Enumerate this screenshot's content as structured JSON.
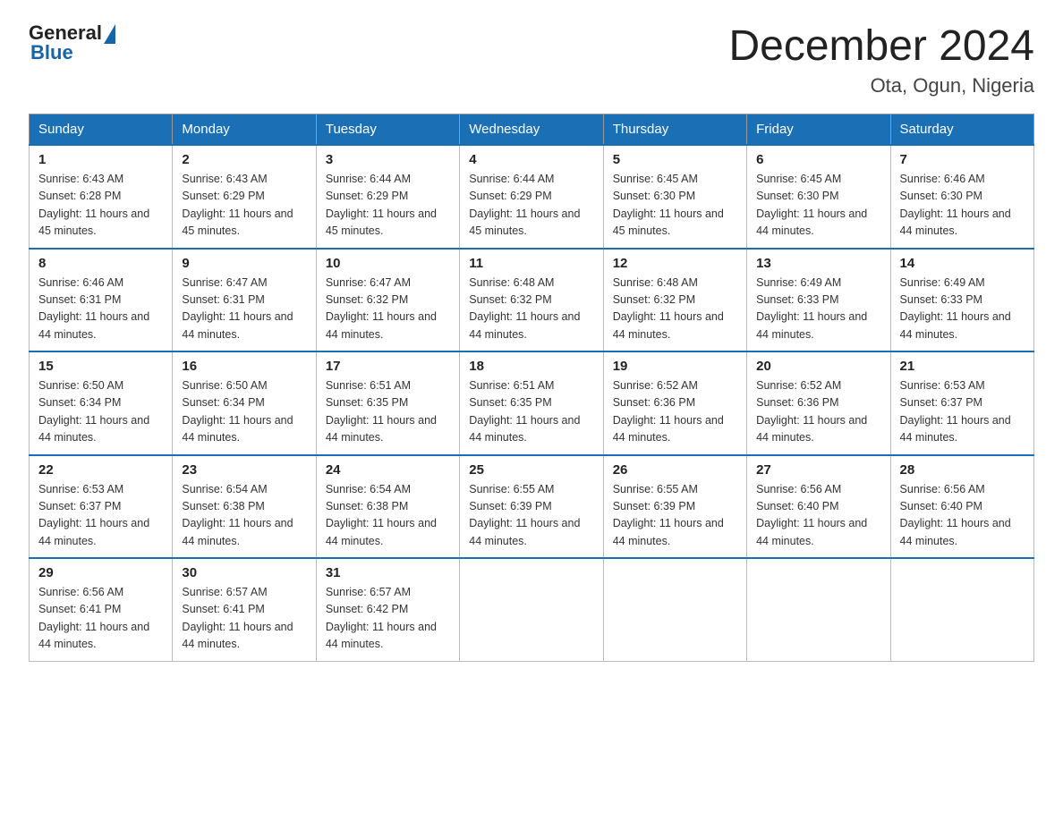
{
  "logo": {
    "general": "General",
    "blue": "Blue"
  },
  "title": "December 2024",
  "subtitle": "Ota, Ogun, Nigeria",
  "weekdays": [
    "Sunday",
    "Monday",
    "Tuesday",
    "Wednesday",
    "Thursday",
    "Friday",
    "Saturday"
  ],
  "weeks": [
    [
      {
        "day": "1",
        "sunrise": "6:43 AM",
        "sunset": "6:28 PM",
        "daylight": "11 hours and 45 minutes."
      },
      {
        "day": "2",
        "sunrise": "6:43 AM",
        "sunset": "6:29 PM",
        "daylight": "11 hours and 45 minutes."
      },
      {
        "day": "3",
        "sunrise": "6:44 AM",
        "sunset": "6:29 PM",
        "daylight": "11 hours and 45 minutes."
      },
      {
        "day": "4",
        "sunrise": "6:44 AM",
        "sunset": "6:29 PM",
        "daylight": "11 hours and 45 minutes."
      },
      {
        "day": "5",
        "sunrise": "6:45 AM",
        "sunset": "6:30 PM",
        "daylight": "11 hours and 45 minutes."
      },
      {
        "day": "6",
        "sunrise": "6:45 AM",
        "sunset": "6:30 PM",
        "daylight": "11 hours and 44 minutes."
      },
      {
        "day": "7",
        "sunrise": "6:46 AM",
        "sunset": "6:30 PM",
        "daylight": "11 hours and 44 minutes."
      }
    ],
    [
      {
        "day": "8",
        "sunrise": "6:46 AM",
        "sunset": "6:31 PM",
        "daylight": "11 hours and 44 minutes."
      },
      {
        "day": "9",
        "sunrise": "6:47 AM",
        "sunset": "6:31 PM",
        "daylight": "11 hours and 44 minutes."
      },
      {
        "day": "10",
        "sunrise": "6:47 AM",
        "sunset": "6:32 PM",
        "daylight": "11 hours and 44 minutes."
      },
      {
        "day": "11",
        "sunrise": "6:48 AM",
        "sunset": "6:32 PM",
        "daylight": "11 hours and 44 minutes."
      },
      {
        "day": "12",
        "sunrise": "6:48 AM",
        "sunset": "6:32 PM",
        "daylight": "11 hours and 44 minutes."
      },
      {
        "day": "13",
        "sunrise": "6:49 AM",
        "sunset": "6:33 PM",
        "daylight": "11 hours and 44 minutes."
      },
      {
        "day": "14",
        "sunrise": "6:49 AM",
        "sunset": "6:33 PM",
        "daylight": "11 hours and 44 minutes."
      }
    ],
    [
      {
        "day": "15",
        "sunrise": "6:50 AM",
        "sunset": "6:34 PM",
        "daylight": "11 hours and 44 minutes."
      },
      {
        "day": "16",
        "sunrise": "6:50 AM",
        "sunset": "6:34 PM",
        "daylight": "11 hours and 44 minutes."
      },
      {
        "day": "17",
        "sunrise": "6:51 AM",
        "sunset": "6:35 PM",
        "daylight": "11 hours and 44 minutes."
      },
      {
        "day": "18",
        "sunrise": "6:51 AM",
        "sunset": "6:35 PM",
        "daylight": "11 hours and 44 minutes."
      },
      {
        "day": "19",
        "sunrise": "6:52 AM",
        "sunset": "6:36 PM",
        "daylight": "11 hours and 44 minutes."
      },
      {
        "day": "20",
        "sunrise": "6:52 AM",
        "sunset": "6:36 PM",
        "daylight": "11 hours and 44 minutes."
      },
      {
        "day": "21",
        "sunrise": "6:53 AM",
        "sunset": "6:37 PM",
        "daylight": "11 hours and 44 minutes."
      }
    ],
    [
      {
        "day": "22",
        "sunrise": "6:53 AM",
        "sunset": "6:37 PM",
        "daylight": "11 hours and 44 minutes."
      },
      {
        "day": "23",
        "sunrise": "6:54 AM",
        "sunset": "6:38 PM",
        "daylight": "11 hours and 44 minutes."
      },
      {
        "day": "24",
        "sunrise": "6:54 AM",
        "sunset": "6:38 PM",
        "daylight": "11 hours and 44 minutes."
      },
      {
        "day": "25",
        "sunrise": "6:55 AM",
        "sunset": "6:39 PM",
        "daylight": "11 hours and 44 minutes."
      },
      {
        "day": "26",
        "sunrise": "6:55 AM",
        "sunset": "6:39 PM",
        "daylight": "11 hours and 44 minutes."
      },
      {
        "day": "27",
        "sunrise": "6:56 AM",
        "sunset": "6:40 PM",
        "daylight": "11 hours and 44 minutes."
      },
      {
        "day": "28",
        "sunrise": "6:56 AM",
        "sunset": "6:40 PM",
        "daylight": "11 hours and 44 minutes."
      }
    ],
    [
      {
        "day": "29",
        "sunrise": "6:56 AM",
        "sunset": "6:41 PM",
        "daylight": "11 hours and 44 minutes."
      },
      {
        "day": "30",
        "sunrise": "6:57 AM",
        "sunset": "6:41 PM",
        "daylight": "11 hours and 44 minutes."
      },
      {
        "day": "31",
        "sunrise": "6:57 AM",
        "sunset": "6:42 PM",
        "daylight": "11 hours and 44 minutes."
      },
      null,
      null,
      null,
      null
    ]
  ]
}
